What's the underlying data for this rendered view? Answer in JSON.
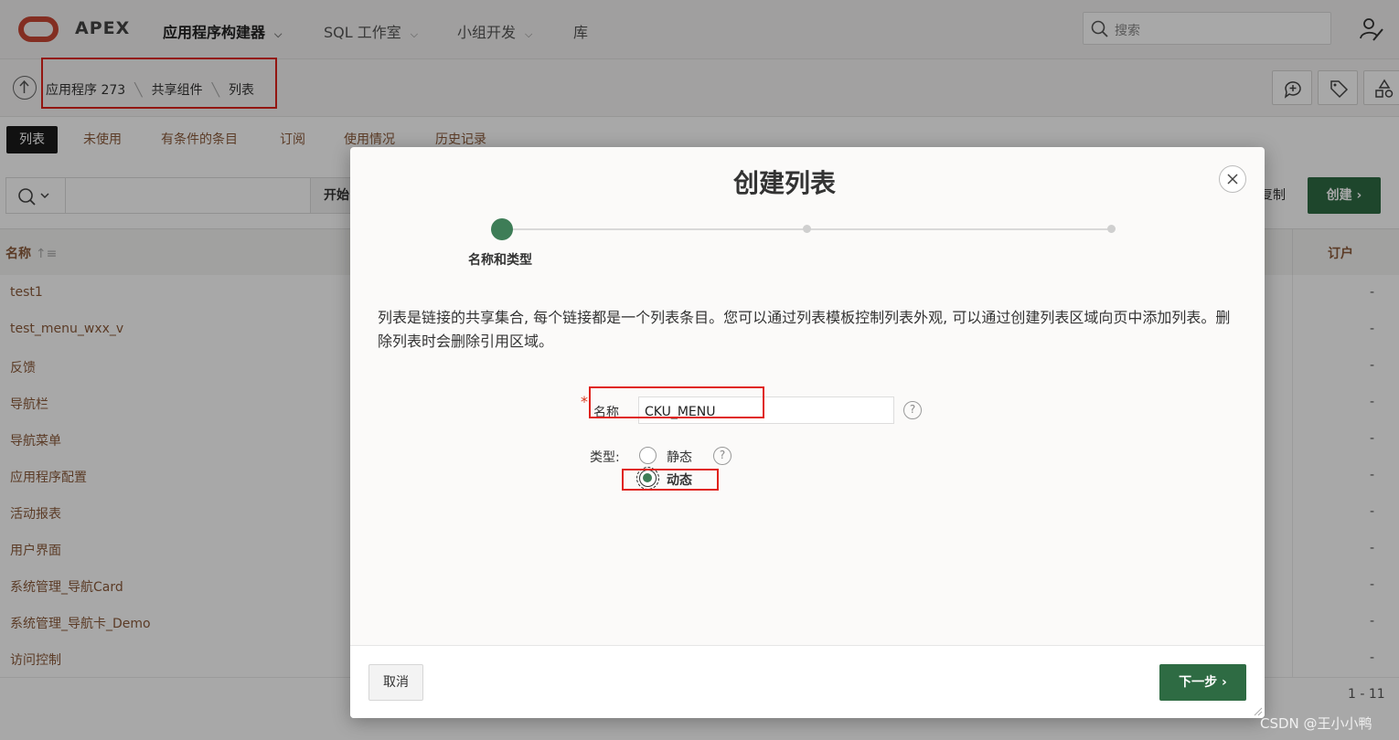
{
  "topnav": {
    "brand": "APEX",
    "items": [
      {
        "label": "应用程序构建器",
        "has_caret": true
      },
      {
        "label": "SQL 工作室",
        "has_caret": true
      },
      {
        "label": "小组开发",
        "has_caret": true
      },
      {
        "label": "库",
        "has_caret": false
      }
    ],
    "search_placeholder": "搜索"
  },
  "breadcrumb": {
    "items": [
      "应用程序 273",
      "共享组件",
      "列表"
    ]
  },
  "tabs": [
    "列表",
    "未使用",
    "有条件的条目",
    "订阅",
    "使用情况",
    "历史记录"
  ],
  "report": {
    "go_label": "开始",
    "copy_label": "复制",
    "create_label": "创建",
    "col_name": "名称",
    "col_subscription": "订户",
    "rows": [
      {
        "name": "test1",
        "sub": "-"
      },
      {
        "name": "test_menu_wxx_v",
        "sub": "-"
      },
      {
        "name": "反馈",
        "sub": "-"
      },
      {
        "name": "导航栏",
        "sub": "-"
      },
      {
        "name": "导航菜单",
        "sub": "-"
      },
      {
        "name": "应用程序配置",
        "sub": "-"
      },
      {
        "name": "活动报表",
        "sub": "-"
      },
      {
        "name": "用户界面",
        "sub": "-"
      },
      {
        "name": "系统管理_导航Card",
        "sub": "-"
      },
      {
        "name": "系统管理_导航卡_Demo",
        "sub": "-"
      },
      {
        "name": "访问控制",
        "sub": "-"
      }
    ],
    "pagination": "1 - 11"
  },
  "dialog": {
    "title": "创建列表",
    "step_label": "名称和类型",
    "description": "列表是链接的共享集合, 每个链接都是一个列表条目。您可以通过列表模板控制列表外观, 可以通过创建列表区域向页中添加列表。删除列表时会删除引用区域。",
    "name_label": "名称",
    "name_value": "CKU_MENU",
    "type_label": "类型:",
    "type_options": [
      "静态",
      "动态"
    ],
    "selected_type": "动态",
    "cancel_label": "取消",
    "next_label": "下一步"
  },
  "watermark": "CSDN @王小小鸭",
  "colors": {
    "accent_green": "#2e6b43",
    "highlight_red": "#e0221b",
    "link_brown": "#8a5a3a"
  }
}
